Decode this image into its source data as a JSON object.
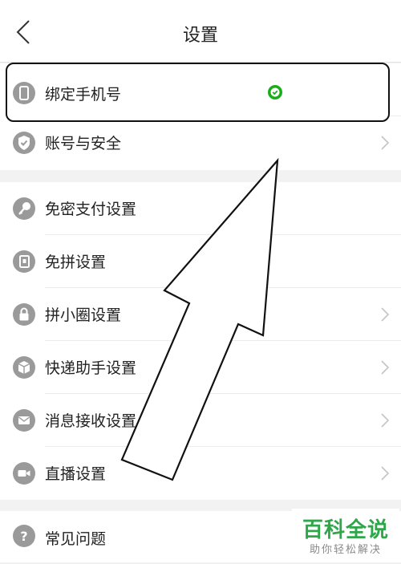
{
  "header": {
    "title": "设置"
  },
  "group1": [
    {
      "label": "绑定手机号",
      "icon": "phone-icon",
      "status": "bound-check-icon"
    },
    {
      "label": "账号与安全",
      "icon": "shield-icon"
    }
  ],
  "group2": [
    {
      "label": "免密支付设置",
      "icon": "key-icon"
    },
    {
      "label": "免拼设置",
      "icon": "card-icon"
    },
    {
      "label": "拼小圈设置",
      "icon": "lock-icon"
    },
    {
      "label": "快递助手设置",
      "icon": "package-icon"
    },
    {
      "label": "消息接收设置",
      "icon": "mail-icon"
    },
    {
      "label": "直播设置",
      "icon": "video-camera-icon"
    }
  ],
  "group3": [
    {
      "label": "常见问题",
      "icon": "question-icon"
    }
  ],
  "watermark": {
    "title": "百科全说",
    "subtitle": "助你轻松解决"
  },
  "colors": {
    "accent_green": "#2fa64a",
    "icon_gray": "#9a9a9a",
    "check_green": "#1aad19"
  }
}
